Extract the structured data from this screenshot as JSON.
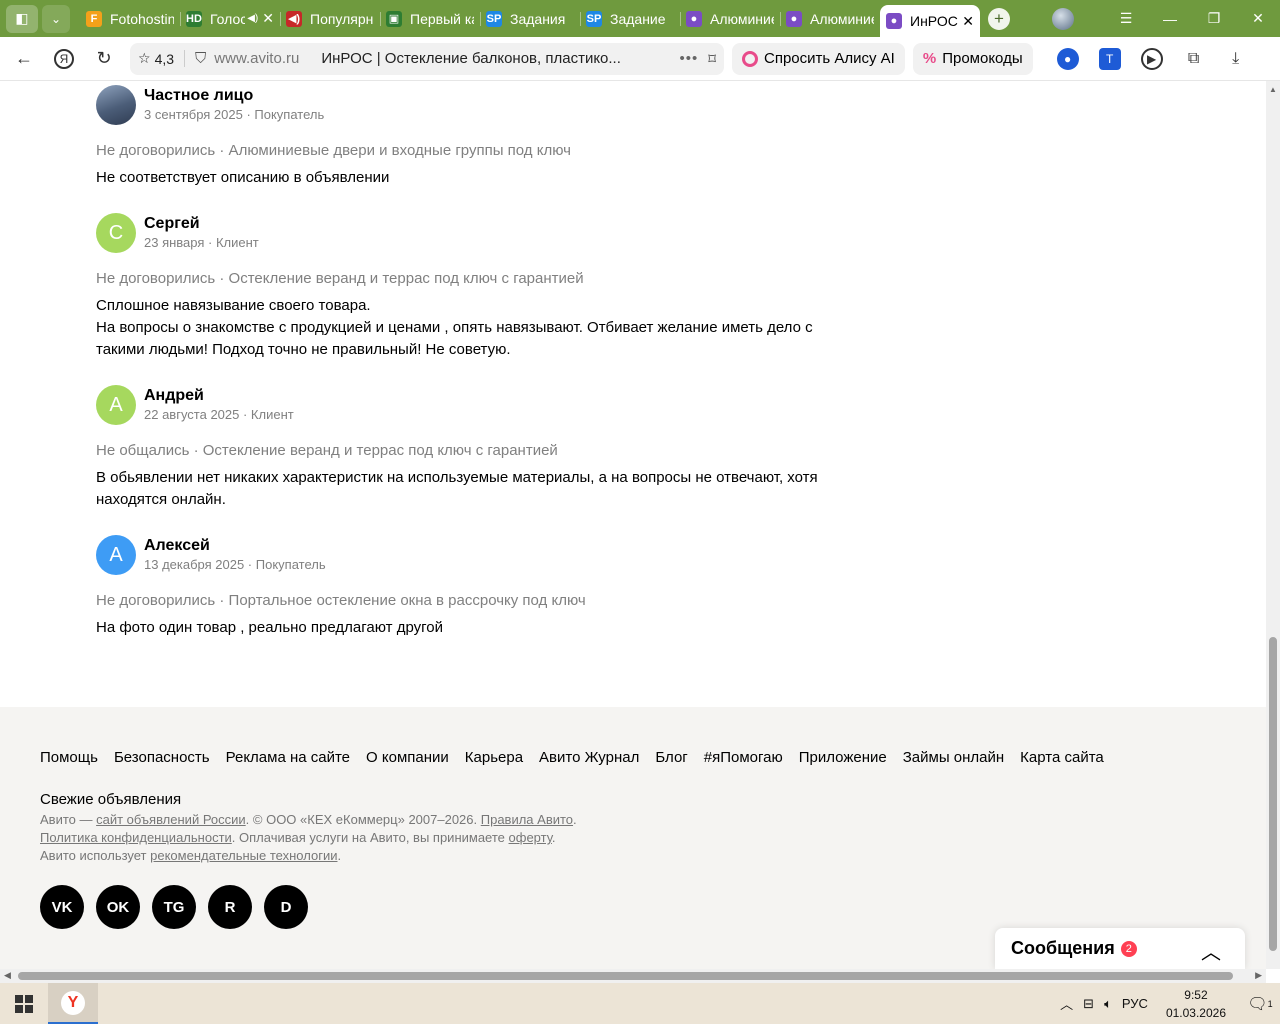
{
  "tabs": [
    {
      "label": "Fotohosting",
      "icon": "F",
      "color": "#f4a11a",
      "text": "#6f3"
    },
    {
      "label": "Голос",
      "icon": "HD",
      "color": "#2e7d32",
      "sound": true,
      "close": true
    },
    {
      "label": "Популярные",
      "icon": "◀)",
      "color": "#c62828"
    },
    {
      "label": "Первый канал",
      "icon": "▣",
      "color": "#2e7d32"
    },
    {
      "label": "Задания",
      "icon": "SP",
      "color": "#1e88e5"
    },
    {
      "label": "Задание",
      "icon": "SP",
      "color": "#1e88e5"
    },
    {
      "label": "Алюминиевые",
      "icon": "●",
      "color": "#7b4cc4"
    },
    {
      "label": "Алюминиевые",
      "icon": "●",
      "color": "#7b4cc4"
    },
    {
      "label": "ИнРОС",
      "icon": "●",
      "color": "#7b4cc4",
      "active": true,
      "close": true
    }
  ],
  "addressbar": {
    "rating": "4,3",
    "host": "www.avito.ru",
    "page_title": "ИнРОС | Остекление балконов, пластико...",
    "alice_label": "Спросить Алису AI",
    "promo_label": "Промокоды"
  },
  "reviews": [
    {
      "name": "Частное лицо",
      "meta": "3 сентября 2025 · Покупатель",
      "avatar_letter": "",
      "avatar_color": "#5a6f8c",
      "deal": "Не договорились · Алюминиевые двери и входные группы под ключ",
      "text": "Не соответствует описанию в объявлении"
    },
    {
      "name": "Сергей",
      "meta": "23 января · Клиент",
      "avatar_letter": "С",
      "avatar_color": "#a6d85e",
      "deal": "Не договорились · Остекление веранд и террас под ключ с гарантией",
      "text": "Сплошное навязывание своего товара.\nНа вопросы о знакомстве с продукцией и ценами , опять навязывают. Отбивает желание иметь дело с такими людьми! Подход точно не правильный! Не советую."
    },
    {
      "name": "Андрей",
      "meta": "22 августа 2025 · Клиент",
      "avatar_letter": "А",
      "avatar_color": "#a6d85e",
      "deal": "Не общались · Остекление веранд и террас под ключ с гарантией",
      "text": "В обьявлении нет никаких характеристик на используемые материалы, а на вопросы не отвечают, хотя находятся онлайн."
    },
    {
      "name": "Алексей",
      "meta": "13 декабря 2025 · Покупатель",
      "avatar_letter": "А",
      "avatar_color": "#3e9cf5",
      "deal": "Не договорились · Портальное остекление окна в рассрочку под ключ",
      "text": "На фото один товар , реально предлагают другой"
    }
  ],
  "footer": {
    "links": [
      "Помощь",
      "Безопасность",
      "Реклама на сайте",
      "О компании",
      "Карьера",
      "Авито Журнал",
      "Блог",
      "#яПомогаю",
      "Приложение",
      "Займы онлайн",
      "Карта сайта",
      "Свежие объявления"
    ],
    "copy": {
      "p1": "Авито — ",
      "l1": "сайт объявлений России",
      "p2": ". © ООО «КЕХ еКоммерц» 2007–2026. ",
      "l2": "Правила Авито",
      "p3": ".",
      "l3": "Политика конфиденциальности",
      "p4": ". Оплачивая услуги на Авито, вы принимаете ",
      "l4": "оферту",
      "p5": ".",
      "p6": "Авито использует ",
      "l5": "рекомендательные технологии",
      "p7": "."
    },
    "socials": [
      "VK",
      "OK",
      "TG",
      "R",
      "D"
    ]
  },
  "messages": {
    "label": "Сообщения",
    "count": "2"
  },
  "taskbar": {
    "lang": "РУС",
    "time": "9:52",
    "date": "01.03.2026",
    "notif_count": "1"
  }
}
